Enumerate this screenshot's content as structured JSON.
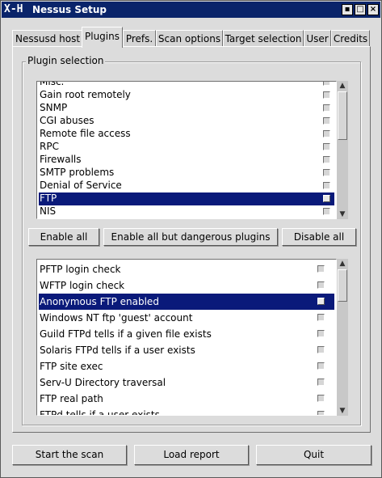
{
  "window": {
    "title": "Nessus Setup",
    "icon_glyph": "X-H",
    "controls": [
      "▪",
      "□",
      "×"
    ]
  },
  "tabs": [
    {
      "label": "Nessusd host",
      "active": false
    },
    {
      "label": "Plugins",
      "active": true
    },
    {
      "label": "Prefs.",
      "active": false
    },
    {
      "label": "Scan options",
      "active": false
    },
    {
      "label": "Target selection",
      "active": false
    },
    {
      "label": "User",
      "active": false
    },
    {
      "label": "Credits",
      "active": false
    }
  ],
  "plugin_selection": {
    "label": "Plugin selection",
    "families": [
      {
        "label": "Misc.",
        "checked": false,
        "selected": false
      },
      {
        "label": "Gain root remotely",
        "checked": false,
        "selected": false
      },
      {
        "label": "SNMP",
        "checked": false,
        "selected": false
      },
      {
        "label": "CGI abuses",
        "checked": false,
        "selected": false
      },
      {
        "label": "Remote file access",
        "checked": false,
        "selected": false
      },
      {
        "label": "RPC",
        "checked": false,
        "selected": false
      },
      {
        "label": "Firewalls",
        "checked": false,
        "selected": false
      },
      {
        "label": "SMTP problems",
        "checked": false,
        "selected": false
      },
      {
        "label": "Denial of Service",
        "checked": false,
        "selected": false
      },
      {
        "label": "FTP",
        "checked": false,
        "selected": true
      },
      {
        "label": "NIS",
        "checked": false,
        "selected": false
      }
    ],
    "buttons": {
      "enable_all": "Enable all",
      "enable_safe": "Enable all but dangerous plugins",
      "disable_all": "Disable all"
    },
    "plugins": [
      {
        "label": "PFTP login check",
        "checked": false,
        "selected": false
      },
      {
        "label": "WFTP login check",
        "checked": false,
        "selected": false
      },
      {
        "label": "Anonymous FTP enabled",
        "checked": false,
        "selected": true
      },
      {
        "label": "Windows NT ftp 'guest' account",
        "checked": false,
        "selected": false
      },
      {
        "label": "Guild FTPd tells if a given file exists",
        "checked": false,
        "selected": false
      },
      {
        "label": "Solaris FTPd tells if a user exists",
        "checked": false,
        "selected": false
      },
      {
        "label": "FTP site exec",
        "checked": false,
        "selected": false
      },
      {
        "label": "Serv-U Directory traversal",
        "checked": false,
        "selected": false
      },
      {
        "label": "FTP real path",
        "checked": false,
        "selected": false
      },
      {
        "label": "FTPd tells if a user exists",
        "checked": false,
        "selected": false
      }
    ]
  },
  "bottom_buttons": {
    "start_scan": "Start the scan",
    "load_report": "Load report",
    "quit": "Quit"
  },
  "colors": {
    "selection": "#0a1a7a",
    "titlebar": "#0a246a",
    "background": "#dcdcdc"
  },
  "icons": {
    "scroll_up": "scroll-up-arrow-icon",
    "scroll_down": "scroll-down-arrow-icon"
  }
}
